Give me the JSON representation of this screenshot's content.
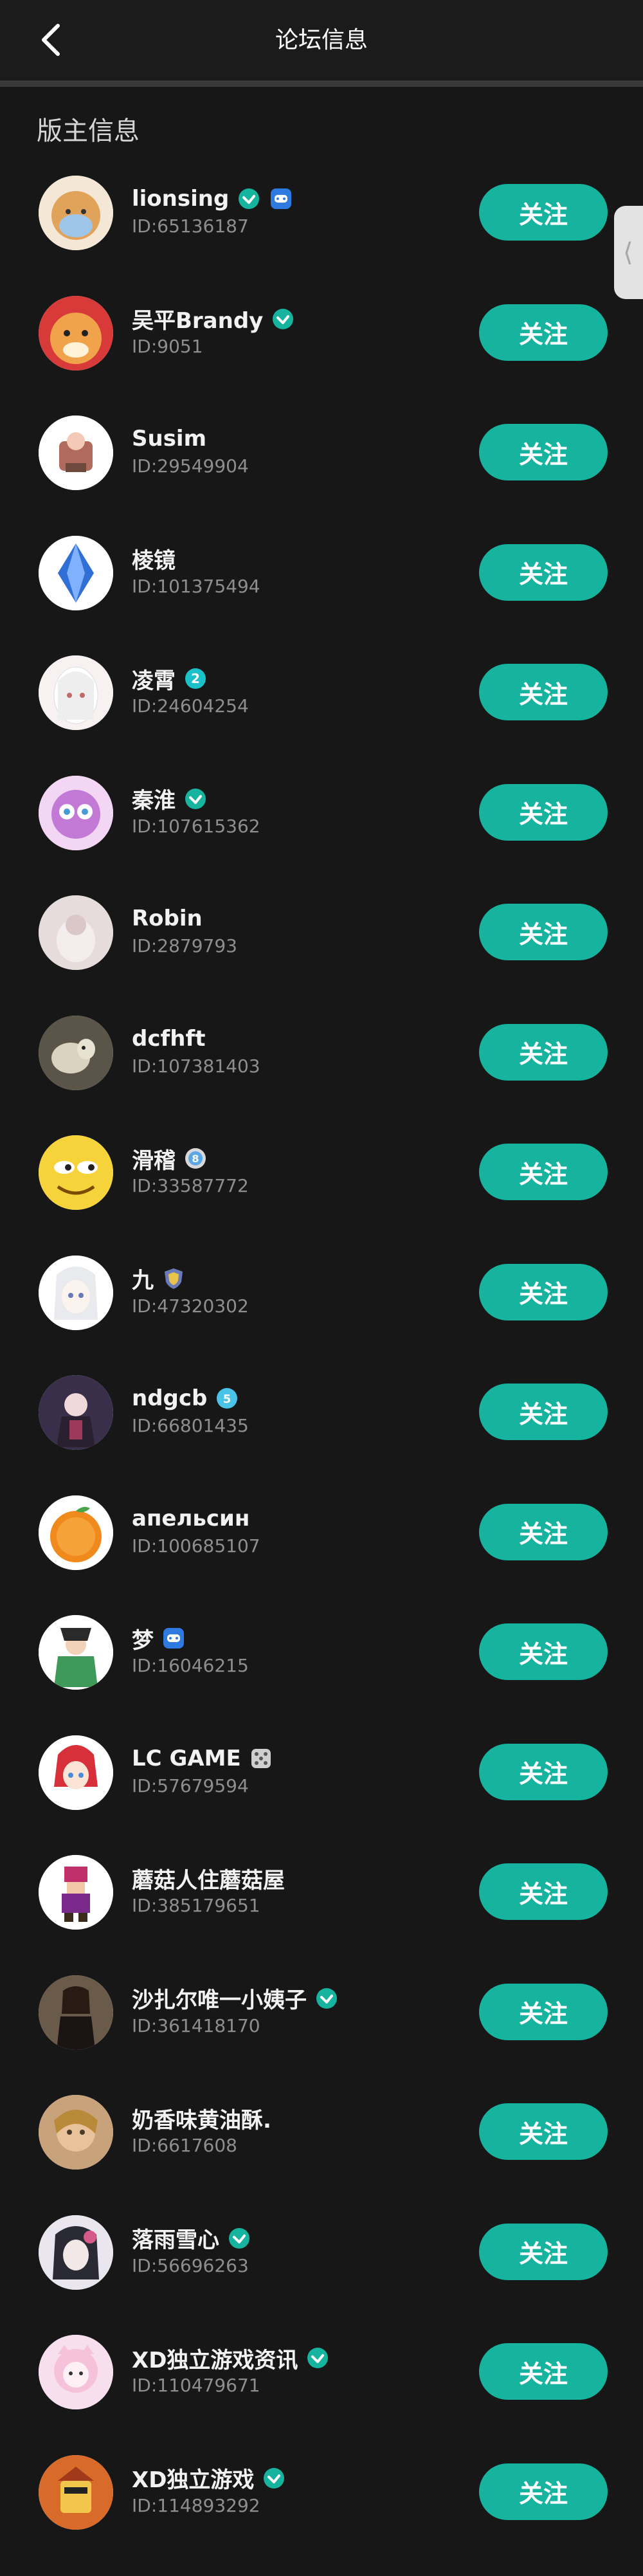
{
  "header": {
    "title": "论坛信息",
    "back_icon": "chevron-left-icon"
  },
  "section": {
    "title": "版主信息"
  },
  "follow_label": "关注",
  "side_tab_glyph": "⟨",
  "colors": {
    "background": "#171717",
    "accent": "#16b49f",
    "id_text": "#8e8e8e"
  },
  "moderators": [
    {
      "name": "lionsing",
      "id": "ID:65136187",
      "badges": [
        "verified-icon",
        "gamepad-badge-icon"
      ]
    },
    {
      "name": "吴平Brandy",
      "id": "ID:9051",
      "badges": [
        "verified-icon"
      ]
    },
    {
      "name": "Susim",
      "id": "ID:29549904",
      "badges": []
    },
    {
      "name": "棱镜",
      "id": "ID:101375494",
      "badges": []
    },
    {
      "name": "凌霄",
      "id": "ID:24604254",
      "badges": [
        "level-2-badge-icon"
      ]
    },
    {
      "name": "秦淮",
      "id": "ID:107615362",
      "badges": [
        "verified-icon"
      ]
    },
    {
      "name": "Robin",
      "id": "ID:2879793",
      "badges": []
    },
    {
      "name": "dcfhft",
      "id": "ID:107381403",
      "badges": []
    },
    {
      "name": "滑稽",
      "id": "ID:33587772",
      "badges": [
        "level-8-badge-icon"
      ]
    },
    {
      "name": "九",
      "id": "ID:47320302",
      "badges": [
        "shield-badge-icon"
      ]
    },
    {
      "name": "ndgcb",
      "id": "ID:66801435",
      "badges": [
        "level-5-badge-icon"
      ]
    },
    {
      "name": "апельсин",
      "id": "ID:100685107",
      "badges": []
    },
    {
      "name": "梦",
      "id": "ID:16046215",
      "badges": [
        "gamepad-badge-icon"
      ]
    },
    {
      "name": "LC GAME",
      "id": "ID:57679594",
      "badges": [
        "dice-badge-icon"
      ]
    },
    {
      "name": "蘑菇人住蘑菇屋",
      "id": "ID:385179651",
      "badges": []
    },
    {
      "name": "沙扎尔唯一小姨子",
      "id": "ID:361418170",
      "badges": [
        "verified-icon"
      ]
    },
    {
      "name": "奶香味黄油酥.",
      "id": "ID:6617608",
      "badges": []
    },
    {
      "name": "落雨雪心",
      "id": "ID:56696263",
      "badges": [
        "verified-icon"
      ]
    },
    {
      "name": "XD独立游戏资讯",
      "id": "ID:110479671",
      "badges": [
        "verified-icon"
      ]
    },
    {
      "name": "XD独立游戏",
      "id": "ID:114893292",
      "badges": [
        "verified-icon"
      ]
    }
  ]
}
